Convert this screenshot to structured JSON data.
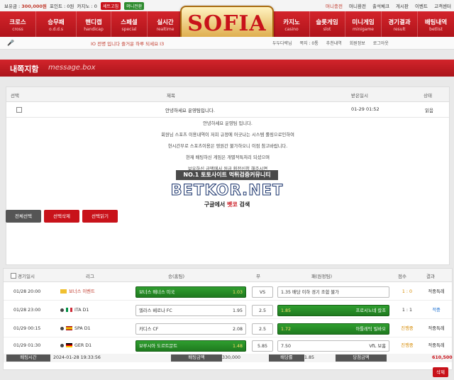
{
  "topbar": {
    "points_label": "보유금 :",
    "points_value": "300,000원",
    "point_label": "포인트 : 0원",
    "casino_label": "카지노 : 0",
    "btn1": "세트고침",
    "btn2": "머니전환",
    "right_items": [
      "머니충전",
      "머니환전",
      "출석체크",
      "게시판",
      "이벤트",
      "고객센터"
    ]
  },
  "nav": {
    "left": [
      {
        "k": "크로스",
        "e": "cross"
      },
      {
        "k": "승무패",
        "e": "o.d.d.s"
      },
      {
        "k": "핸디캡",
        "e": "handicap"
      },
      {
        "k": "스페셜",
        "e": "special"
      },
      {
        "k": "실시간",
        "e": "realtime"
      }
    ],
    "right": [
      {
        "k": "카지노",
        "e": "casino"
      },
      {
        "k": "슬롯게임",
        "e": "slot"
      },
      {
        "k": "미니게임",
        "e": "minigame"
      },
      {
        "k": "경기결과",
        "e": "result"
      },
      {
        "k": "배팅내역",
        "e": "betlist"
      }
    ],
    "logo": "SOFIA"
  },
  "notice": {
    "text": "IO 전명 입니다 즐거운 하루 되세요 I3",
    "right_items": [
      "두두다략님",
      "쪽지 : 0통",
      "추천내역",
      "회원정보",
      "로그아웃"
    ]
  },
  "title": {
    "main": "내쪽지함",
    "sub": "message.box"
  },
  "message": {
    "headers": [
      "선택",
      "제목",
      "받은일시",
      "상태"
    ],
    "row": {
      "title": "안녕하세요 운영팀입니다.",
      "date": "01-29 01:52",
      "status": "읽음"
    },
    "body": [
      "안녕하세요 운영팀 입니다.",
      "회원님 스포츠 이용내역이 저희 규정에 어긋나는 시스템 롤링으로인하여",
      "현시간부로 스포츠이용은 영원간 불가하오니 이점 참고바랍니다.",
      "현재 배팅하신 게임은 개별적특처리 되셨으며",
      "보유하신 금액에서 원금 환전신청 해주시면"
    ],
    "wm1": "NO.1 토토사이트 먹튀검증커뮤니티",
    "wm2": "BETKOR.NET",
    "wm3_a": "구글에서",
    "wm3_b": "벳코",
    "wm3_c": "검색",
    "buttons": [
      "전체선택",
      "선택삭제",
      "선택읽기"
    ]
  },
  "bet": {
    "headers": [
      "경기일시",
      "리그",
      "승(홈팀)",
      "무",
      "패(원정팀)",
      "점수",
      "결과"
    ],
    "rows": [
      {
        "date": "01/28 20:00",
        "league": "보너스 이벤트",
        "home": "보너스 배너스 미국",
        "home_odds": "1.03",
        "draw": "VS",
        "away": "1.35 배당 이하 경기 조합 불가",
        "away_odds": "",
        "score": "1 : 0",
        "result": "적중특례",
        "home_sel": true,
        "away_sel": false
      },
      {
        "date": "01/28 23:00",
        "league": "ITA D1",
        "home": "엘라스 베로나 FC",
        "home_odds": "1.95",
        "draw": "2.5",
        "away": "프로시노네 칼초",
        "away_odds": "1.85",
        "score": "1 : 1",
        "result": "적중",
        "home_sel": false,
        "away_sel": true
      },
      {
        "date": "01/29 00:15",
        "league": "SPA D1",
        "home": "카디스 CF",
        "home_odds": "2.08",
        "draw": "2.5",
        "away": "아틀레틱 빌바오",
        "away_odds": "1.72",
        "score": "진행중",
        "result": "적중특례",
        "home_sel": false,
        "away_sel": true
      },
      {
        "date": "01/29 01:30",
        "league": "GER D1",
        "home": "보루시아 도르트문트",
        "home_odds": "1.48",
        "draw": "5.85",
        "away": "VfL 보훔",
        "away_odds": "7.50",
        "score": "진행중",
        "result": "적중특례",
        "home_sel": true,
        "away_sel": false
      }
    ],
    "footer": {
      "time_label": "배팅시간",
      "time": "2024-01-28 19:33:56",
      "amount_label": "배팅금액",
      "amount": "330,000",
      "rate_label": "배당률",
      "rate": "1.85",
      "win_label": "당첨금액",
      "win": "610,500"
    },
    "delete": "삭제"
  }
}
